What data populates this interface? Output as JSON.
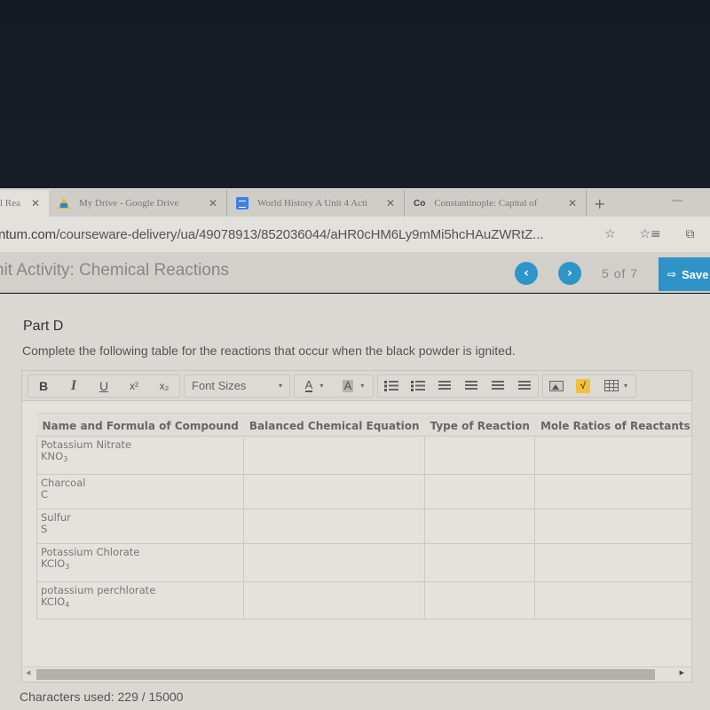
{
  "browser": {
    "tabs": [
      {
        "label": "l Rea",
        "icon": "reader-icon"
      },
      {
        "label": "My Drive - Google Drive",
        "icon": "google-drive-icon"
      },
      {
        "label": "World History A Unit 4 Acti",
        "icon": "google-docs-icon"
      },
      {
        "label": "Constantinople: Capital of",
        "icon": "co-favicon",
        "favicon_text": "Co"
      }
    ],
    "close_glyph": "✕",
    "new_tab_glyph": "+",
    "minimize_glyph": "—",
    "url_host": "ntum.com",
    "url_path": "/courseware-delivery/ua/49078913/852036044/aHR0cHM6Ly9mMi5hcHAuZWRtZ...",
    "address_icons": {
      "favorite": "☆",
      "favorites_list": "☆≡",
      "extensions": "⧉"
    }
  },
  "header": {
    "activity_title": "nit Activity: Chemical Reactions",
    "prev_glyph": "‹",
    "next_glyph": "›",
    "page_current": "5",
    "page_of": "of",
    "page_total": "7",
    "save_label": "Save"
  },
  "content": {
    "part_title": "Part D",
    "instructions": "Complete the following table for the reactions that occur when the black powder is ignited."
  },
  "toolbar": {
    "bold": "B",
    "italic": "I",
    "underline": "U",
    "superscript": "x²",
    "subscript": "x₂",
    "font_sizes": "Font Sizes",
    "text_color": "A",
    "highlight_color": "A",
    "caret": "▾",
    "math": "√"
  },
  "table": {
    "headers": [
      "Name and Formula of Compound",
      "Balanced Chemical Equation",
      "Type of Reaction",
      "Mole Ratios of Reactants to Produ"
    ],
    "rows": [
      {
        "name": "Potassium Nitrate",
        "formula_base": "KNO",
        "formula_sub": "3",
        "equation": "",
        "type": "",
        "ratios": ""
      },
      {
        "name": "Charcoal",
        "formula_base": "C",
        "formula_sub": "",
        "equation": "",
        "type": "",
        "ratios": ""
      },
      {
        "name": "Sulfur",
        "formula_base": "S",
        "formula_sub": "",
        "equation": "",
        "type": "",
        "ratios": ""
      },
      {
        "name": "Potassium Chlorate",
        "formula_base": "KClO",
        "formula_sub": "3",
        "equation": "",
        "type": "",
        "ratios": ""
      },
      {
        "name": "potassium perchlorate",
        "formula_base": "KClO",
        "formula_sub": "4",
        "equation": "",
        "type": "",
        "ratios": ""
      }
    ]
  },
  "scrollbar": {
    "left_glyph": "◀",
    "right_glyph": "▶"
  },
  "footer": {
    "characters_used": "Characters used: 229 / 15000"
  }
}
